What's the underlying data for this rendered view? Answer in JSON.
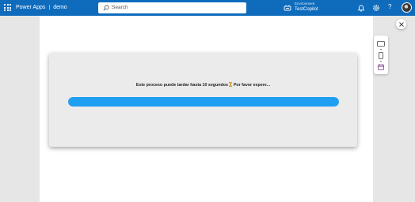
{
  "header": {
    "app_name": "Power Apps",
    "separator": "|",
    "project_name": "demo",
    "search_placeholder": "Search",
    "environment_label": "Environment",
    "environment_name": "TestCopilot",
    "help_label": "?"
  },
  "dialog": {
    "message": "Este proceso puede tardar hasta 10 segundos",
    "message_suffix": "Por favor espere...",
    "progress_percent": 100,
    "progress_color": "#1e9ff2"
  },
  "colors": {
    "topbar": "#0f6cbd",
    "canvas_backdrop": "#e6e6e6",
    "panel": "#ebebeb"
  },
  "icons": {
    "app_launcher": "waffle-icon",
    "search": "search-icon",
    "environment": "environment-icon",
    "notifications": "bell-icon",
    "settings": "gear-icon",
    "help": "help-icon",
    "close": "close-icon",
    "devices": [
      "tablet-icon",
      "phone-icon",
      "calendar-icon"
    ]
  }
}
